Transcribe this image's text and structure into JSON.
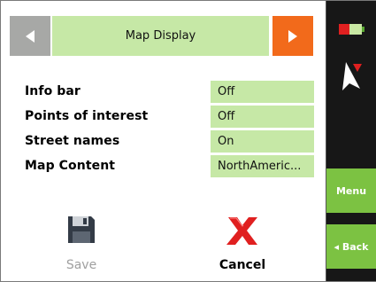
{
  "header": {
    "title": "Map Display",
    "prev_icon": "arrow-left-icon",
    "next_icon": "arrow-right-icon"
  },
  "settings": [
    {
      "label": "Info bar",
      "value": "Off"
    },
    {
      "label": "Points of interest",
      "value": "Off"
    },
    {
      "label": "Street names",
      "value": "On"
    },
    {
      "label": "Map Content",
      "value": "NorthAmeric..."
    }
  ],
  "actions": {
    "save": {
      "label": "Save",
      "icon": "floppy-disk-icon",
      "enabled": false
    },
    "cancel": {
      "label": "Cancel",
      "icon": "red-x-icon"
    }
  },
  "sidebar": {
    "battery_icon": "battery-icon",
    "compass_icon": "compass-arrow-icon",
    "menu_label": "Menu",
    "back_label": "◂ Back"
  },
  "colors": {
    "accent_green": "#c6e8a6",
    "sidebar_green": "#7cc242",
    "next_orange": "#f26a1b",
    "prev_gray": "#a7a8a6",
    "cancel_red": "#e02020"
  }
}
